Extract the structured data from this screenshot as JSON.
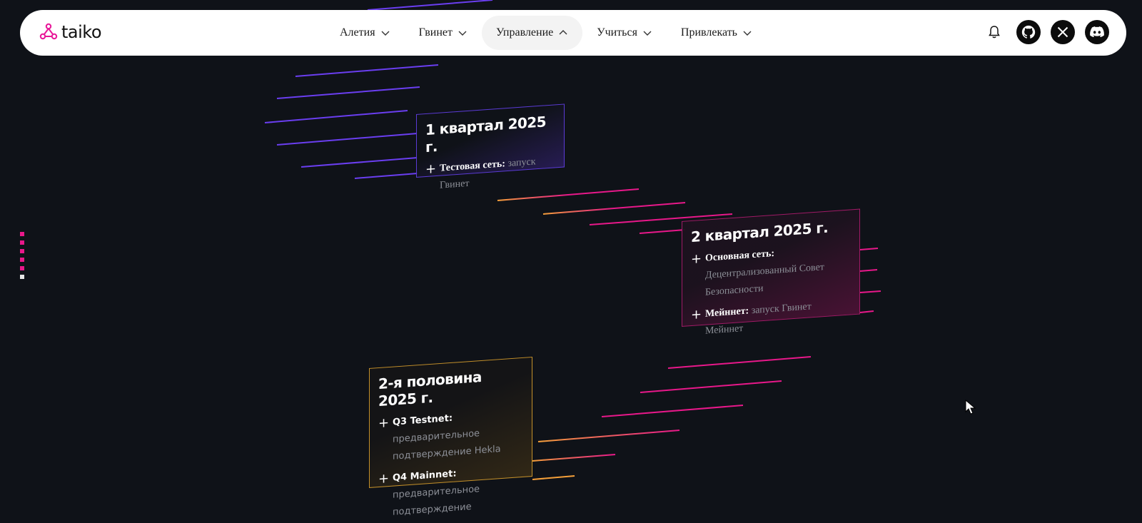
{
  "brand": {
    "name": "taiko",
    "color": "#e81899"
  },
  "nav": {
    "items": [
      {
        "label": "Алетия",
        "icon": "chevron-down-icon"
      },
      {
        "label": "Гвинет",
        "icon": "chevron-down-icon"
      },
      {
        "label": "Управление",
        "icon": "chevron-up-icon"
      },
      {
        "label": "Учиться",
        "icon": "chevron-down-icon"
      },
      {
        "label": "Привлекать",
        "icon": "chevron-down-icon"
      }
    ],
    "icons": [
      "bell-icon",
      "github-icon",
      "x-icon",
      "discord-icon"
    ]
  },
  "roadmap": [
    {
      "title": "1 квартал 2025 г.",
      "accent": "#5b3bd6",
      "items": [
        {
          "bold": "Тестовая сеть:",
          "text": " запуск Гвинет"
        }
      ]
    },
    {
      "title": "2 квартал 2025 г.",
      "accent": "#e81899",
      "items": [
        {
          "bold": "Основная сеть:",
          "text": " Децентрализованный Совет Безопасности"
        },
        {
          "bold": "Мейннет:",
          "text": " запуск Гвинет Мейннет"
        }
      ]
    },
    {
      "title": "2-я половина 2025 г.",
      "accent": "#f0a030",
      "items": [
        {
          "bold": "Q3 Testnet:",
          "text": " предварительное подтверждение Hekla"
        },
        {
          "bold": "Q4 Mainnet:",
          "text": " предварительное подтверждение"
        }
      ]
    }
  ],
  "colors": {
    "background": "#0f1218",
    "purple": "#6a3ef0",
    "pink": "#e8188a",
    "orange": "#f5a03a"
  }
}
